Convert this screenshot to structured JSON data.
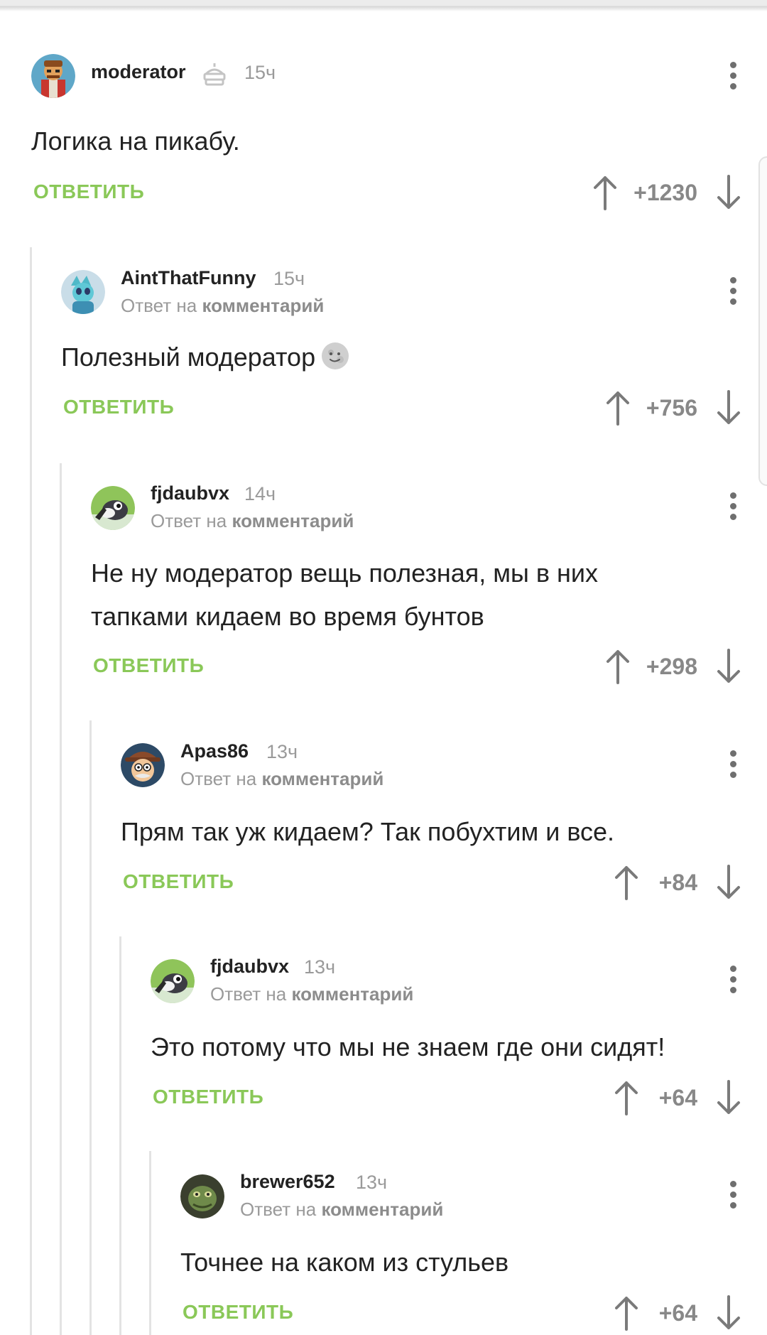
{
  "reply_label": "ОТВЕТИТЬ",
  "reply_to_prefix": "Ответ на",
  "reply_to_target": "комментарий",
  "comments": [
    {
      "user": "moderator",
      "time": "15ч",
      "text": "Логика на пикабу.",
      "score": "+1230"
    },
    {
      "user": "AintThatFunny",
      "time": "15ч",
      "text": "Полезный модератор",
      "score": "+756"
    },
    {
      "user": "fjdaubvx",
      "time": "14ч",
      "text": "Не ну модератор вещь полезная, мы в них\nтапками кидаем во время бунтов",
      "score": "+298"
    },
    {
      "user": "Apas86",
      "time": "13ч",
      "text": "Прям так уж кидаем? Так побухтим и все.",
      "score": "+84"
    },
    {
      "user": "fjdaubvx",
      "time": "13ч",
      "text": "Это потому что мы не знаем где они сидят!",
      "score": "+64"
    },
    {
      "user": "brewer652",
      "time": "13ч",
      "text": "Точнее на каком из стульев",
      "score": "+64"
    }
  ],
  "colors": {
    "accent": "#8ac858",
    "muted": "#9a9a9a",
    "text": "#222222",
    "thread_line": "#e3e3e3"
  },
  "icons": {
    "moderator_badge": "cake-badge-icon",
    "emoji": "moon-face-emoji",
    "upvote": "arrow-up-icon",
    "downvote": "arrow-down-icon",
    "menu": "more-vertical-icon"
  }
}
